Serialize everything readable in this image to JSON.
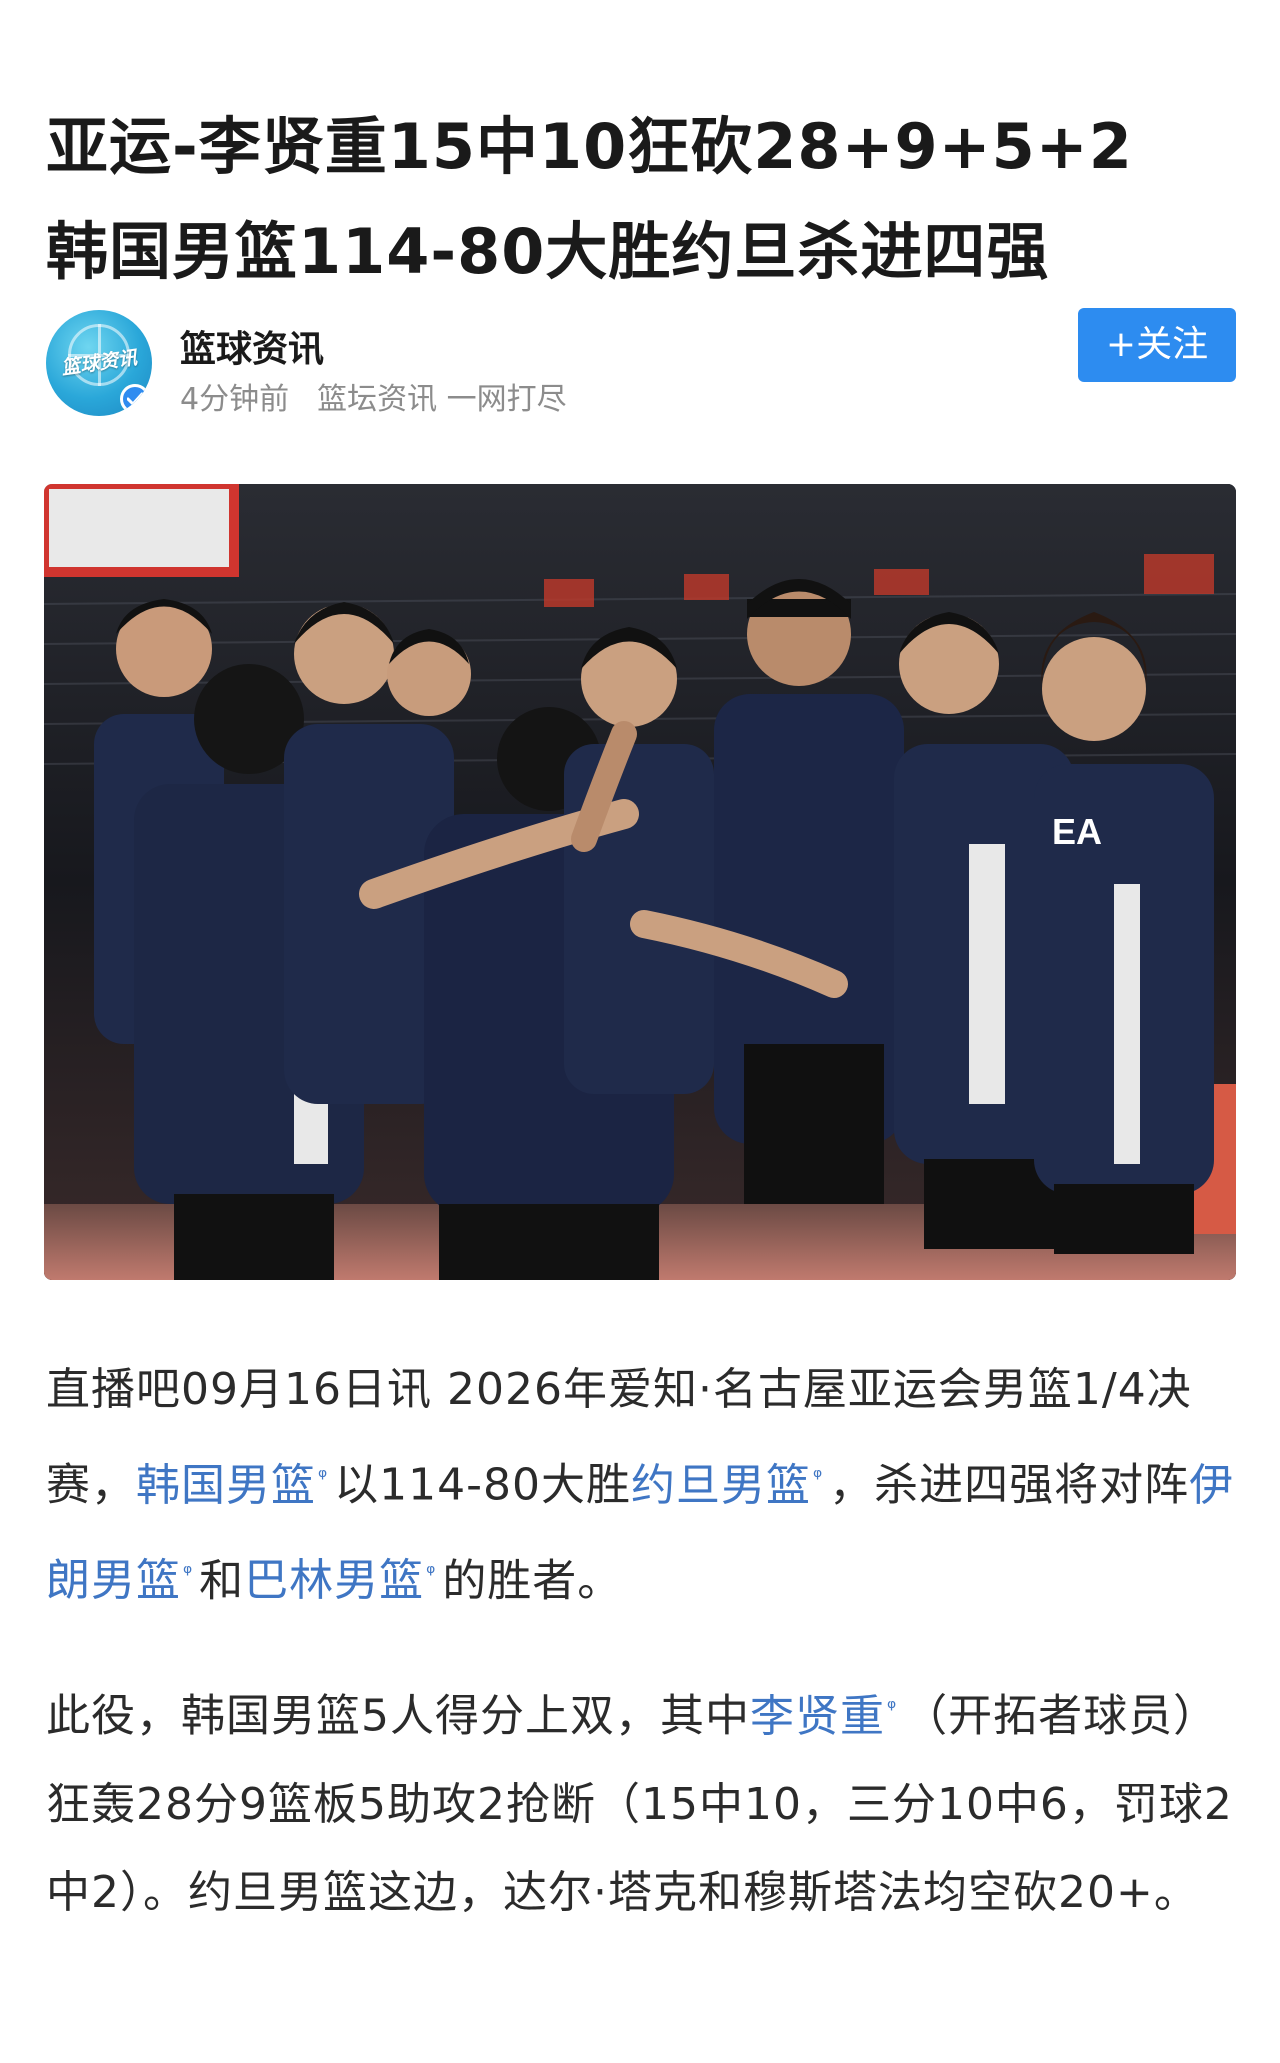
{
  "article": {
    "title_line_1": "亚运-李贤重15中10狂砍28+9+5+2",
    "title_line_2": "韩国男篮114-80大胜约旦杀进四强"
  },
  "author": {
    "avatar_text": "篮球资讯",
    "name": "篮球资讯",
    "time": "4分钟前",
    "tagline": "篮坛资讯 一网打尽",
    "follow_label": "+关注"
  },
  "photo": {
    "jersey_text": "EA"
  },
  "body": {
    "p1": {
      "t1": "直播吧09月16日讯  2026年爱知·名古屋亚运会男篮1/4决赛，",
      "link1": "韩国男篮",
      "t2": "以114-80大胜",
      "link2": "约旦男篮",
      "t3": "，杀进四强将对阵",
      "link3": "伊朗男篮",
      "t4": "和",
      "link4": "巴林男篮",
      "t5": "的胜者。"
    },
    "p2": {
      "t1": "此役，韩国男篮5人得分上双，其中",
      "link1": "李贤重",
      "t2": "（开拓者球员）狂轰28分9篮板5助攻2抢断（15中10，三分10中6，罚球2中2）。约旦男篮这边，达尔·塔克和穆斯塔法均空砍20+。"
    },
    "search_glyph": "ᵠ"
  },
  "colors": {
    "link": "#3f76c4",
    "follow_button": "#2d8cf0",
    "meta_gray": "#8c8c8c",
    "jersey_navy": "#1f2a4a"
  }
}
